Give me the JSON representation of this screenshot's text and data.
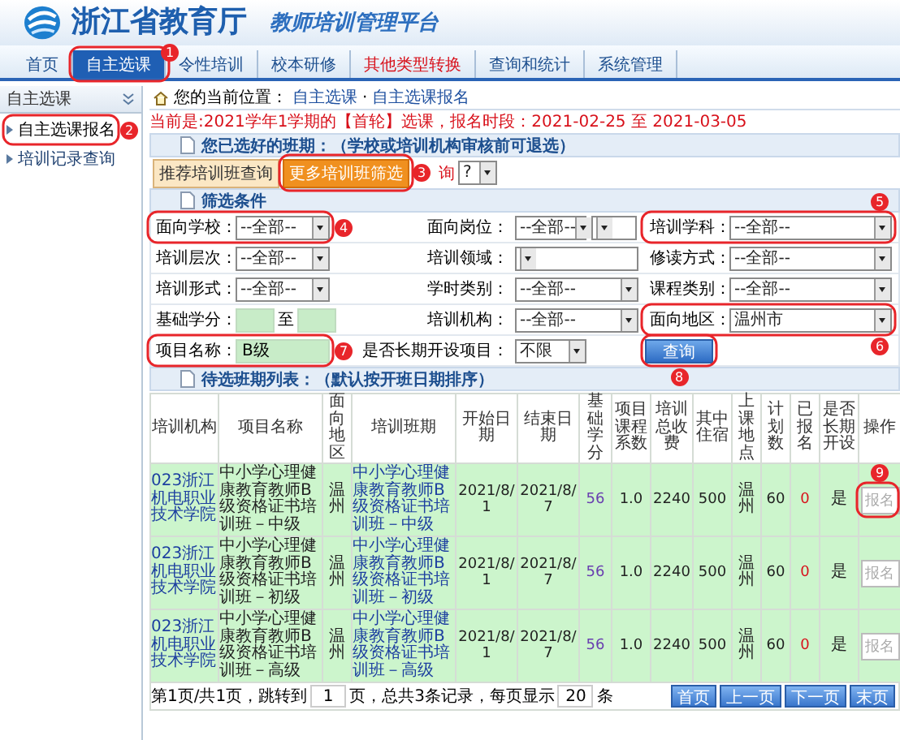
{
  "header": {
    "title": "浙江省教育厅",
    "subtitle": "教师培训管理平台"
  },
  "nav": [
    {
      "label": "首页",
      "selected": false,
      "kind": "plain"
    },
    {
      "label": "自主选课",
      "selected": true,
      "kind": "plain"
    },
    {
      "label": "令性培训",
      "selected": false,
      "kind": "plain"
    },
    {
      "label": "校本研修",
      "selected": false,
      "kind": "plain"
    },
    {
      "label": "其他类型转换",
      "selected": false,
      "kind": "alert"
    },
    {
      "label": "查询和统计",
      "selected": false,
      "kind": "plain"
    },
    {
      "label": "系统管理",
      "selected": false,
      "kind": "plain"
    }
  ],
  "sidebar": {
    "title": "自主选课",
    "items": [
      {
        "label": "自主选课报名",
        "selected": true
      },
      {
        "label": "培训记录查询",
        "selected": false
      }
    ]
  },
  "breadcrumb": {
    "label": "您的当前位置：",
    "separator": "·",
    "path": [
      "自主选课",
      "自主选课报名"
    ]
  },
  "notice": "当前是:2021学年1学期的【首轮】选课，报名时段：2021-02-25 至 2021-03-05",
  "selected_section": {
    "title": "您已选好的班期：（学校或培训机构审核前可退选）"
  },
  "query_tabs": [
    {
      "label": "推荐培训班查询",
      "selected": false
    },
    {
      "label": "更多培训班筛选",
      "selected": true
    }
  ],
  "query_extra": {
    "label": "询",
    "value": "?"
  },
  "filter": {
    "title": "筛选条件",
    "rows": [
      [
        {
          "kind": "select",
          "label": "面向学校：",
          "value": "--全部--"
        },
        {
          "kind": "select_pair",
          "label": "面向岗位：",
          "value": "--全部--"
        },
        {
          "kind": "select",
          "label": "培训学科：",
          "value": "--全部--"
        }
      ],
      [
        {
          "kind": "select",
          "label": "培训层次：",
          "value": "--全部--"
        },
        {
          "kind": "select",
          "label": "培训领域："
        },
        {
          "kind": "select",
          "label": "修读方式：",
          "value": "--全部--"
        }
      ],
      [
        {
          "kind": "select",
          "label": "培训形式：",
          "value": "--全部--"
        },
        {
          "kind": "select",
          "label": "学时类别：",
          "value": "--全部--"
        },
        {
          "kind": "select",
          "label": "课程类别：",
          "value": "--全部--"
        }
      ],
      [
        {
          "kind": "range",
          "label": "基础学分：",
          "to": "至"
        },
        {
          "kind": "select",
          "label": "培训机构：",
          "value": "--全部--"
        },
        {
          "kind": "select",
          "label": "面向地区：",
          "value": "温州市"
        }
      ],
      [
        {
          "kind": "text",
          "label": "项目名称：",
          "value": "B级"
        },
        {
          "kind": "select_small",
          "label": "是否长期开设项目：",
          "value": "不限"
        },
        {
          "kind": "button",
          "label": "查询"
        }
      ]
    ]
  },
  "list_section": {
    "title": "待选班期列表：（默认按开班日期排序）"
  },
  "table": {
    "columns": [
      "培训机构",
      "项目名称",
      "面向地区",
      "培训班期",
      "开始日期",
      "结束日期",
      "基础学分",
      "项目课程系数",
      "培训总收费",
      "其中住宿",
      "上课地点",
      "计划数",
      "已报名",
      "是否长期开设",
      "操作"
    ],
    "rows": [
      {
        "cells": [
          "023浙江机电职业技术学院",
          "中小学心理健康教育教师B级资格证书培训班－中级",
          "温州",
          "中小学心理健康教育教师B级资格证书培训班－中级",
          "2021/8/1",
          "2021/8/7",
          "56",
          "1.0",
          "2240",
          "500",
          "温州",
          "60",
          "0",
          "是"
        ],
        "action": "报名",
        "disabled": true
      },
      {
        "cells": [
          "023浙江机电职业技术学院",
          "中小学心理健康教育教师B级资格证书培训班－初级",
          "温州",
          "中小学心理健康教育教师B级资格证书培训班－初级",
          "2021/8/1",
          "2021/8/7",
          "56",
          "1.0",
          "2240",
          "500",
          "温州",
          "60",
          "0",
          "是"
        ],
        "action": "报名",
        "disabled": true
      },
      {
        "cells": [
          "023浙江机电职业技术学院",
          "中小学心理健康教育教师B级资格证书培训班－高级",
          "温州",
          "中小学心理健康教育教师B级资格证书培训班－高级",
          "2021/8/1",
          "2021/8/7",
          "56",
          "1.0",
          "2240",
          "500",
          "温州",
          "60",
          "0",
          "是"
        ],
        "action": "报名",
        "disabled": true
      }
    ]
  },
  "pagination": {
    "before": "第1页/共1页，跳转到",
    "page": "1",
    "middle": "页，总共3条记录，每页显示",
    "per_page": "20",
    "after": "条",
    "buttons": [
      "首页",
      "上一页",
      "下一页",
      "末页"
    ]
  },
  "annotations": [
    {
      "number": "1"
    },
    {
      "number": "2"
    },
    {
      "number": "3"
    },
    {
      "number": "4"
    },
    {
      "number": "5"
    },
    {
      "number": "6"
    },
    {
      "number": "7"
    },
    {
      "number": "8"
    },
    {
      "number": "9"
    }
  ]
}
